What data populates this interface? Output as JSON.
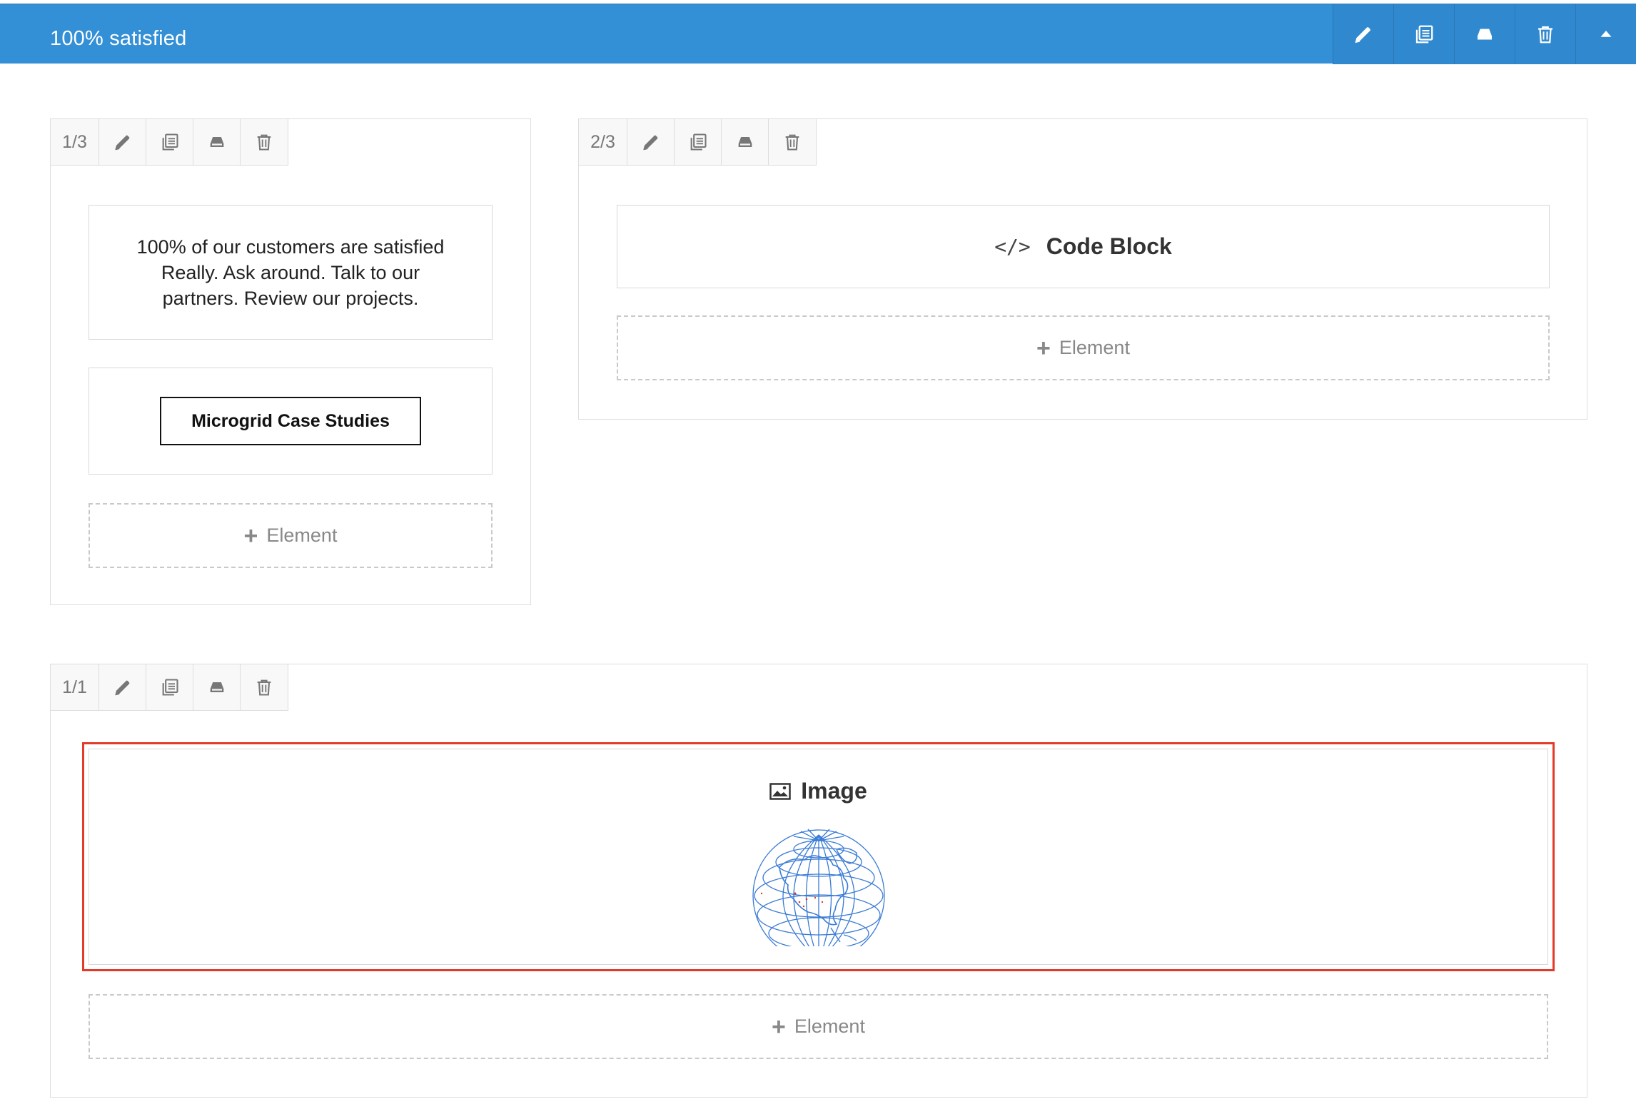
{
  "section": {
    "title": "100% satisfied",
    "tools": [
      "pencil-icon",
      "duplicate-icon",
      "save-icon",
      "trash-icon",
      "collapse-arrow-icon"
    ]
  },
  "columns": [
    {
      "size": "1/3",
      "elements": {
        "text_lines": [
          "100% of our customers are satisfied",
          "Really. Ask around. Talk to our",
          "partners. Review our projects."
        ],
        "button_label": "Microgrid Case Studies"
      },
      "add_label": "Element"
    },
    {
      "size": "2/3",
      "elements": {
        "code_block_label": "Code Block",
        "code_icon": "</>"
      },
      "add_label": "Element"
    },
    {
      "size": "1/1",
      "elements": {
        "image_label": "Image"
      },
      "add_label": "Element"
    }
  ],
  "colors": {
    "accent": "#338fd6",
    "selection": "#e33b2a",
    "globe": "#3a7bd5"
  }
}
